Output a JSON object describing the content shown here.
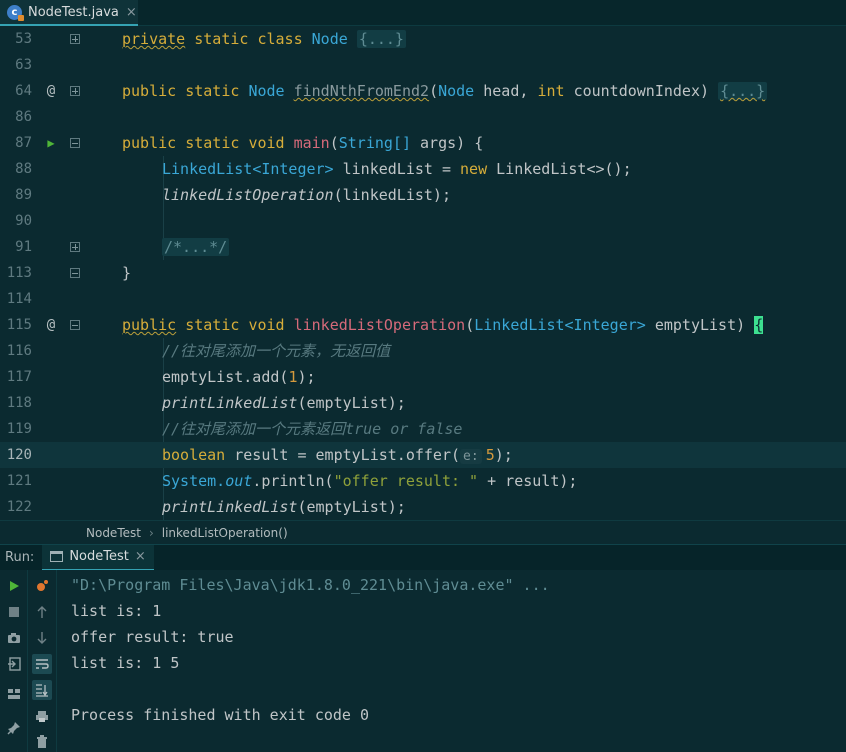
{
  "tab": {
    "icon_letter": "c",
    "label": "NodeTest.java",
    "close": "×"
  },
  "editor": {
    "lines": [
      {
        "n": "53"
      },
      {
        "n": "63"
      },
      {
        "n": "64"
      },
      {
        "n": "86"
      },
      {
        "n": "87"
      },
      {
        "n": "88"
      },
      {
        "n": "89"
      },
      {
        "n": "90"
      },
      {
        "n": "91"
      },
      {
        "n": "113"
      },
      {
        "n": "114"
      },
      {
        "n": "115"
      },
      {
        "n": "116"
      },
      {
        "n": "117"
      },
      {
        "n": "118"
      },
      {
        "n": "119"
      },
      {
        "n": "120"
      },
      {
        "n": "121"
      },
      {
        "n": "122"
      }
    ],
    "code": {
      "l53": {
        "kw1": "private",
        "kw2": "static",
        "kw3": "class",
        "cls": "Node",
        "fold": "{...}"
      },
      "l64": {
        "kw1": "public",
        "kw2": "static",
        "ty": "Node",
        "fn": "findNthFromEnd2",
        "p1ty": "Node",
        "p1": "head,",
        "p2ty": "int",
        "p2": "countdownIndex)",
        "fold": "{...}"
      },
      "l87": {
        "kw1": "public",
        "kw2": "static",
        "kw3": "void",
        "fn": "main",
        "p1ty": "String[]",
        "p1": "args)",
        "brace": "{"
      },
      "l88": {
        "ty1": "LinkedList",
        "gen": "<Integer>",
        "var": "linkedList =",
        "kw": "new",
        "ctor": "LinkedList",
        "rest": "<>();"
      },
      "l89": {
        "call": "linkedListOperation",
        "args": "(linkedList);"
      },
      "l91": {
        "fold": "/*...*/"
      },
      "l113": {
        "brace": "}"
      },
      "l115": {
        "kw1": "public",
        "kw2": "static",
        "kw3": "void",
        "fn": "linkedListOperation",
        "p1ty": "LinkedList",
        "gen": "<Integer>",
        "p1": "emptyList)",
        "brace": "{"
      },
      "l116": {
        "comment": "//往对尾添加一个元素，无返回值"
      },
      "l117": {
        "pre": "emptyList.add(",
        "num": "1",
        "post": ");"
      },
      "l118": {
        "call": "printLinkedList",
        "args": "(emptyList);"
      },
      "l119": {
        "comment": "//往对尾添加一个元素返回true or false"
      },
      "l120": {
        "kw": "boolean",
        "pre": "result = emptyList.offer(",
        "hint": "e:",
        "num": "5",
        "post": ");"
      },
      "l121": {
        "sys": "System.",
        "out": "out",
        "mid": ".println(",
        "str": "\"offer result: \"",
        "post": " + result);"
      },
      "l122": {
        "call": "printLinkedList",
        "args": "(emptyList);"
      }
    },
    "gutter_marks": {
      "l64": "@",
      "l87": "▶",
      "l115": "@"
    }
  },
  "breadcrumb": {
    "class": "NodeTest",
    "sep": "›",
    "method": "linkedListOperation()"
  },
  "run": {
    "label": "Run:",
    "tab_label": "NodeTest",
    "tab_close": "×",
    "console": [
      "\"D:\\Program Files\\Java\\jdk1.8.0_221\\bin\\java.exe\" ...",
      "list is: 1",
      "offer result: true",
      "list is: 1 5",
      "",
      "Process finished with exit code 0"
    ]
  }
}
